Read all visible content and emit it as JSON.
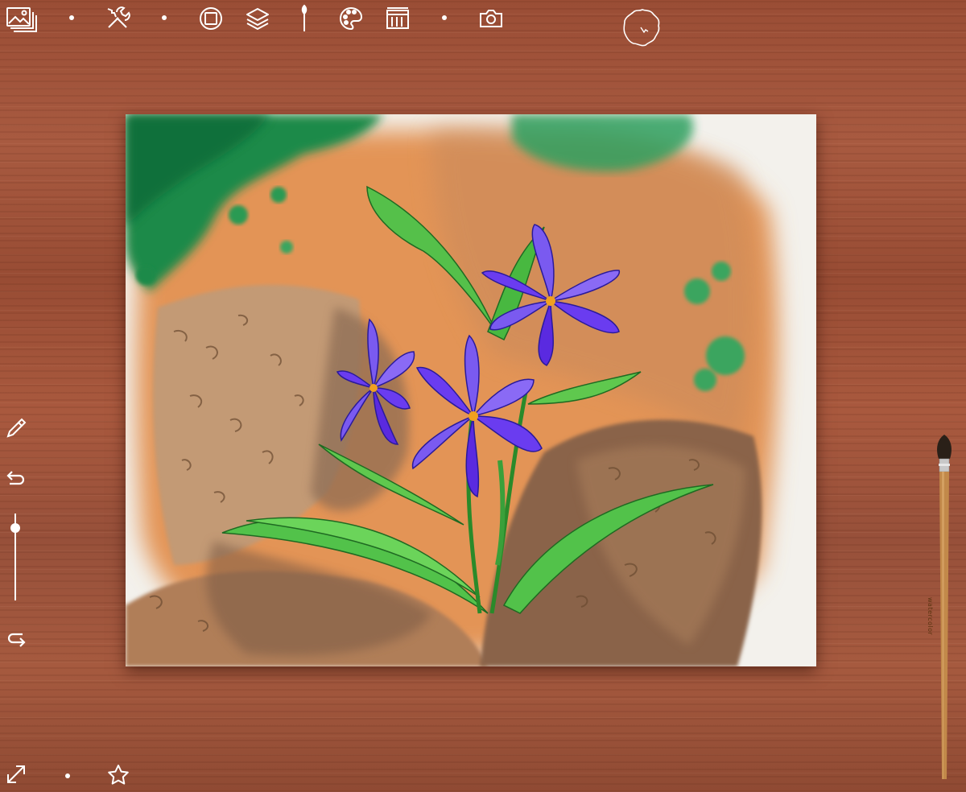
{
  "toolbar": {
    "items": [
      {
        "name": "gallery-icon"
      },
      {
        "name": "tools-icon"
      },
      {
        "name": "paper-icon"
      },
      {
        "name": "layers-icon"
      },
      {
        "name": "brush-icon"
      },
      {
        "name": "palette-icon"
      },
      {
        "name": "mixer-icon"
      },
      {
        "name": "camera-icon"
      }
    ],
    "current_brush_preview": "brush-tip-icon"
  },
  "side_tools": {
    "eyedropper": "eyedropper-icon",
    "undo": "undo-icon",
    "redo": "redo-icon",
    "brush_size_level": 0.12
  },
  "bottom_tools": {
    "fullscreen": "expand-icon",
    "favorites": "star-icon"
  },
  "brush_handle_text": "watercolor",
  "colors": {
    "wood": "#a0543a",
    "paper": "#f3f1ec",
    "petal": "#6a3cf0",
    "leaf": "#3fc24a",
    "soil": "#b07850",
    "orange_wash": "#e08a4a",
    "moss": "#1f8a48"
  }
}
